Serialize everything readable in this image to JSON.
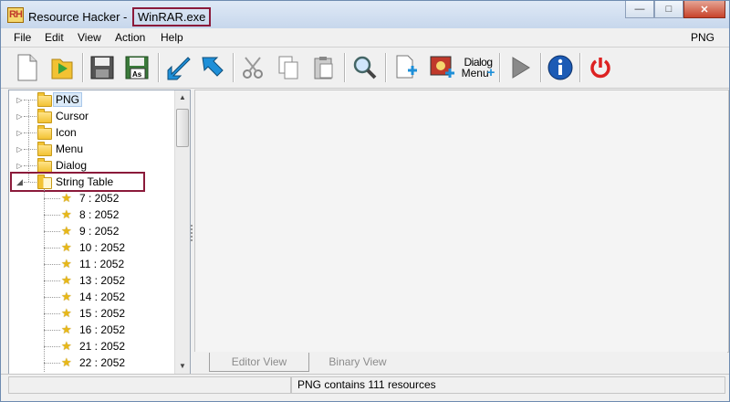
{
  "window": {
    "app_name": "Resource Hacker",
    "title_sep": " - ",
    "file_name": "WinRAR.exe",
    "icon_text": "RH",
    "buttons": {
      "minimize": "—",
      "maximize": "□",
      "close": "✕"
    }
  },
  "menu": {
    "items": [
      "File",
      "Edit",
      "View",
      "Action",
      "Help"
    ],
    "right_label": "PNG"
  },
  "toolbar": {
    "dialog_label_1": "Dialog",
    "dialog_label_2": "Menu"
  },
  "tree": {
    "nodes": [
      {
        "label": "PNG",
        "type": "folder",
        "selected": true
      },
      {
        "label": "Cursor",
        "type": "folder"
      },
      {
        "label": "Icon",
        "type": "folder"
      },
      {
        "label": "Menu",
        "type": "folder"
      },
      {
        "label": "Dialog",
        "type": "folder"
      },
      {
        "label": "String Table",
        "type": "folder-open",
        "expanded": true
      }
    ],
    "children": [
      "7 : 2052",
      "8 : 2052",
      "9 : 2052",
      "10 : 2052",
      "11 : 2052",
      "13 : 2052",
      "14 : 2052",
      "15 : 2052",
      "16 : 2052",
      "21 : 2052",
      "22 : 2052"
    ]
  },
  "tabs": {
    "editor": "Editor View",
    "binary": "Binary View"
  },
  "status": {
    "text": "PNG contains 111 resources"
  },
  "colors": {
    "highlight_box": "#8b1a3a",
    "selection": "#dbeaf9"
  }
}
